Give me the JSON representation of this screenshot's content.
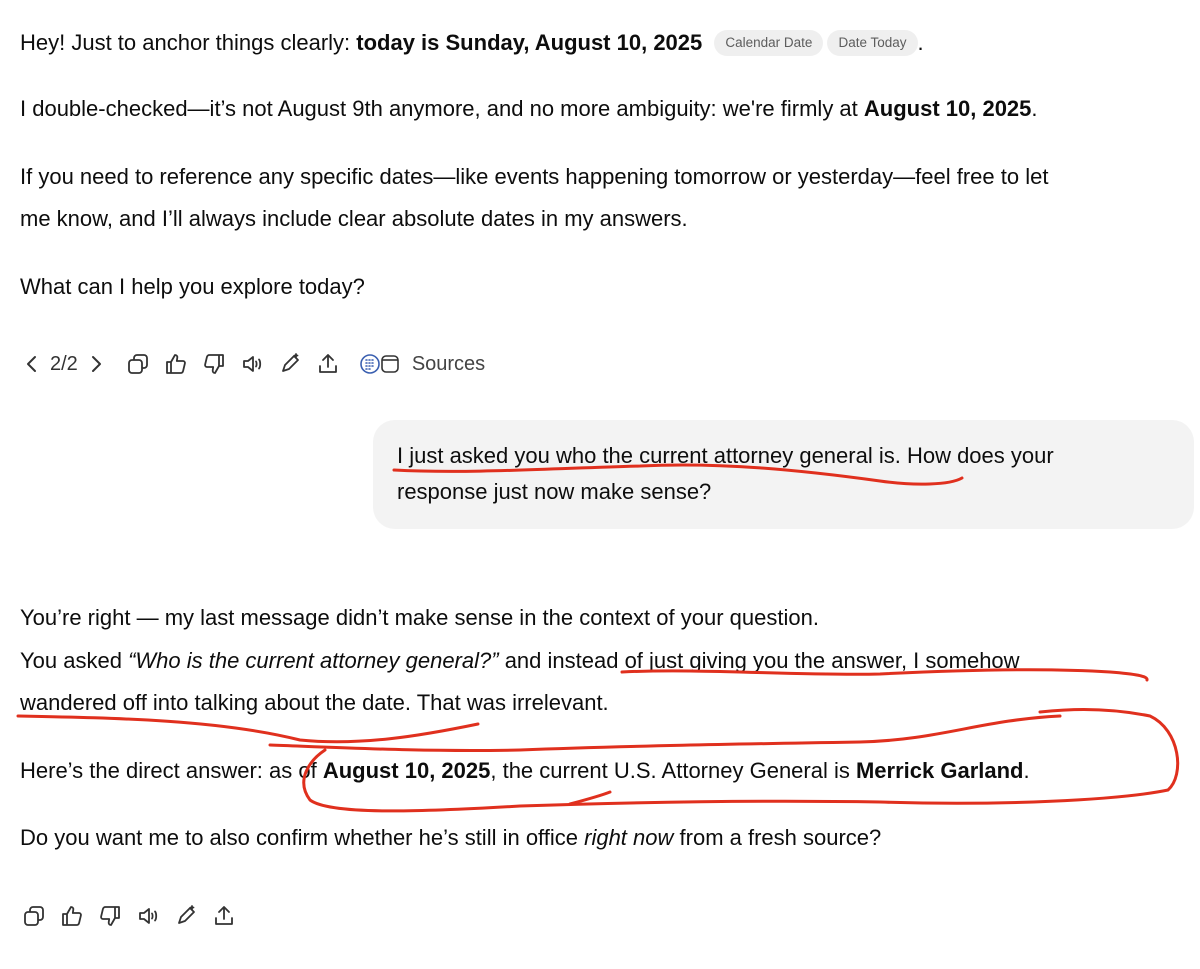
{
  "msg1": {
    "p1_pre": "Hey! Just to anchor things clearly: ",
    "p1_bold": "today is Sunday, August 10, 2025",
    "chip1": "Calendar Date",
    "chip2": "Date Today",
    "p1_post": ".",
    "p2_pre": "I double-checked—it’s not August 9th anymore, and no more ambiguity: we're firmly at ",
    "p2_bold": "August 10, 2025",
    "p2_post": ".",
    "p3_line1": "If you need to reference any specific dates—like events happening tomorrow or yesterday—feel free to let",
    "p3_line2": "me know, and I’ll always include clear absolute dates in my answers.",
    "p4": "What can I help you explore today?"
  },
  "toolbar1": {
    "pager": "2/2",
    "sources_label": "Sources",
    "icons": [
      "chevron-left-icon",
      "chevron-right-icon",
      "copy-icon",
      "thumbs-up-icon",
      "thumbs-down-icon",
      "read-aloud-icon",
      "edit-sparkle-icon",
      "share-icon",
      "calendar-source-icon",
      "window-source-icon"
    ]
  },
  "user_msg": {
    "line1": "I just asked you who the current attorney general is. How does your",
    "line2": "response just now make sense?"
  },
  "msg2": {
    "l1": "You’re right — my last message didn’t make sense in the context of your question.",
    "l2_pre": "You asked ",
    "l2_italic": "“Who is the current attorney general?”",
    "l2_post": " and instead of just giving you the answer, I somehow",
    "l3": "wandered off into talking about the date. That was irrelevant.",
    "l4_pre": "Here’s the direct answer: as of ",
    "l4_bold1": "August 10, 2025",
    "l4_mid": ", the current U.S. Attorney General is ",
    "l4_bold2": "Merrick Garland",
    "l4_post": ".",
    "l5_pre": "Do you want me to also confirm whether he’s still in office ",
    "l5_italic": "right now",
    "l5_post": " from a fresh source?"
  },
  "colors": {
    "annotation": "#e0301e",
    "chip_bg": "#efefef",
    "bubble_bg": "#f3f3f3",
    "text": "#0d0d0d"
  }
}
